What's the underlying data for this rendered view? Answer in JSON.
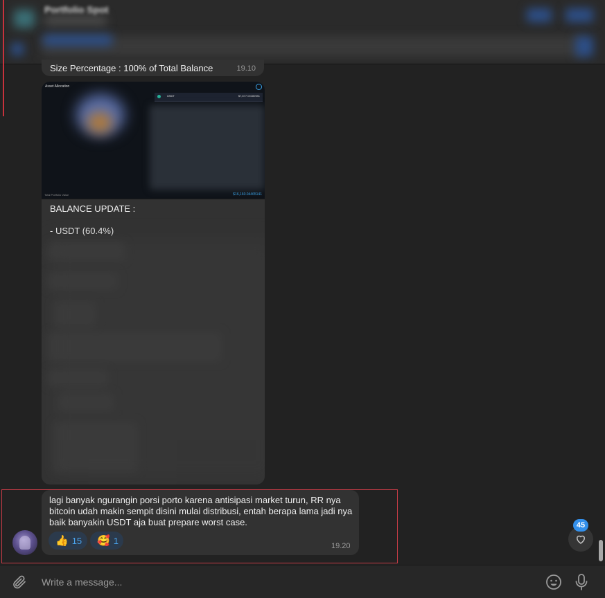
{
  "header": {
    "title": "Portfolio Spot"
  },
  "messages": {
    "top": {
      "text": "Size Percentage : 100% of Total Balance",
      "time": "19.10"
    },
    "media": {
      "image_title": "Asset Allocation",
      "image_footer_left": "Total Portfolio Value",
      "image_footer_right": "$16,160.04465141",
      "image_row_coin": "USDT",
      "image_row_value": "$7,877.00280981",
      "caption_title": "BALANCE UPDATE :",
      "caption_line1": "- USDT (60.4%)"
    },
    "last": {
      "text": "lagi banyak ngurangin porsi porto karena antisipasi market turun, RR nya bitcoin udah makin sempit disini mulai distribusi, entah berapa lama jadi nya  baik banyakin USDT aja buat prepare worst case.",
      "time": "19.20",
      "reactions": [
        {
          "emoji": "👍",
          "count": "15"
        },
        {
          "emoji": "🥰",
          "count": "1"
        }
      ]
    }
  },
  "side": {
    "badge_count": "45"
  },
  "composer": {
    "placeholder": "Write a message..."
  },
  "colors": {
    "accent": "#3390ec",
    "highlight": "#c63c46",
    "bubble": "#323232",
    "background": "#222222"
  },
  "icons": {
    "attach": "paperclip-icon",
    "emoji": "smiley-icon",
    "mic": "microphone-icon",
    "heart": "heart-icon"
  }
}
